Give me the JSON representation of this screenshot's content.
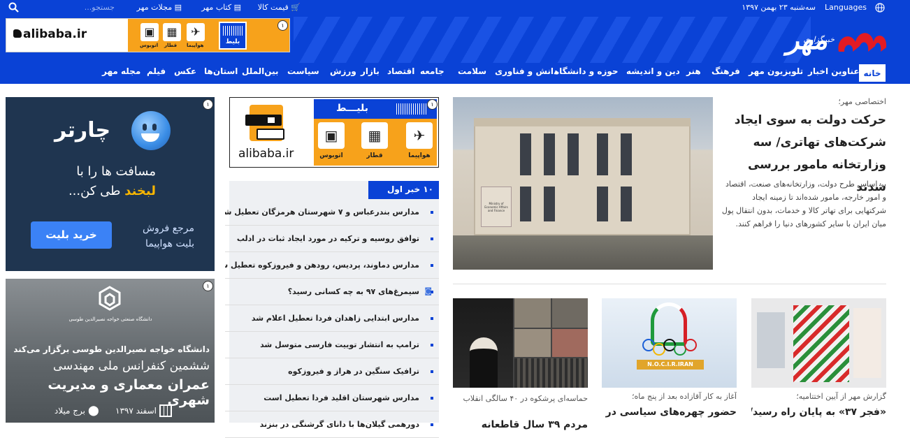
{
  "topbar": {
    "languages": "Languages",
    "date": "سه‌شنبه ۲۳ بهمن ۱۳۹۷",
    "price": "قیمت کالا",
    "book": "کتاب مهر",
    "magazines": "مجلات مهر",
    "search_placeholder": "جستجو..."
  },
  "logo": {
    "text": "مهر",
    "subtext": "خبرگزاری"
  },
  "nav": [
    "خانه",
    "عناوین اخبار",
    "تلویزیون مهر",
    "فرهنگ",
    "هنر",
    "دین و اندیشه",
    "حوزه و دانشگاه",
    "دانش و فناوری",
    "سلامت",
    "جامعه",
    "اقتصاد",
    "بازار",
    "ورزش",
    "سیاست",
    "بین‌الملل",
    "استان‌ها",
    "عکس",
    "فیلم",
    "مجله مهر"
  ],
  "ad_top": {
    "brand": "alibaba.ir",
    "ticket": "بلیط",
    "plane": "هواپیما",
    "train": "قطار",
    "bus": "اتوبوس",
    "badge": "۱"
  },
  "ad_mid": {
    "brand": "alibaba.ir",
    "ticket": "بلیـــط",
    "plane": "هواپیما",
    "train": "قطار",
    "bus": "اتوبوس",
    "badge": "۱"
  },
  "ad_charter": {
    "brand": "چارتر",
    "line1": "مسافت ها را با",
    "line2a": "لبخند",
    "line2b": " طی کن...",
    "ref1": "مرجع فروش",
    "ref2": "بلیت هواپیما",
    "btn": "خرید بلیت",
    "badge": "۱"
  },
  "ad_conf": {
    "org": "دانشگاه صنعتی خواجه نصیرالدین طوسی",
    "line1": "دانشگاه خواجه نصیرالدین طوسی برگزار می‌کند",
    "line2": "ششمین کنفرانس ملی مهندسی",
    "line3": "عمران معماری و مدیریت شهری",
    "date": "اسفند ۱۳۹۷",
    "place": "برج میلاد",
    "badge": "۱"
  },
  "top10": {
    "title": "۱۰ خبر اول",
    "items": [
      "مدارس بندرعباس و ۷ شهرستان هرمزگان تعطیل شد",
      "توافق روسیه و ترکیه در مورد ایجاد ثبات در ادلب",
      "مدارس دماوند، پردیس، رودهن و فیروزکوه تعطیل شد",
      "سیمرغ‌های ۹۷ به چه کسانی رسید؟",
      "مدارس ابتدایی زاهدان فردا تعطیل اعلام شد",
      "ترامپ به انتشار توییت فارسی متوسل شد",
      "ترافیک سنگین در هراز و فیروزکوه",
      "مدارس شهرستان اقلید فردا تعطیل است",
      "دورهمی گیلان‌ها با دانای گرشنگی در بنزند"
    ]
  },
  "lead": {
    "kicker": "اختصاصی مهر؛",
    "title": "حرکت دولت به سوی ایجاد شرکت‌های تهاتری/ سه وزارتخانه مامور بررسی شدند",
    "summary": "بر اساس طرح دولت، وزارتخانه‌های صنعت، اقتصاد و امور خارجه، مامور شده‌اند تا زمینه ایجاد شرکتهایی برای تهاتر کالا و خدمات، بدون انتقال پول میان ایران با سایر کشورهای دنیا را فراهم کنند.",
    "sign": "Ministry of Economic Affairs and Finance"
  },
  "cards": [
    {
      "kicker": "گزارش مهر از آیین اختتامیه؛",
      "title": "«فجر ۳۷» به پایان راه رسید/"
    },
    {
      "kicker": "آغاز به کار آقازاده بعد از پنج ماه؛",
      "title": "حضور چهره‌های سیاسی در",
      "image_text": "N.O.C.I.R.IRAN"
    },
    {
      "kicker": "حماسه‌ای پرشکوه در ۴۰ سالگی انقلاب",
      "title": "مردم ۳۹ سال قاطعانه"
    }
  ]
}
